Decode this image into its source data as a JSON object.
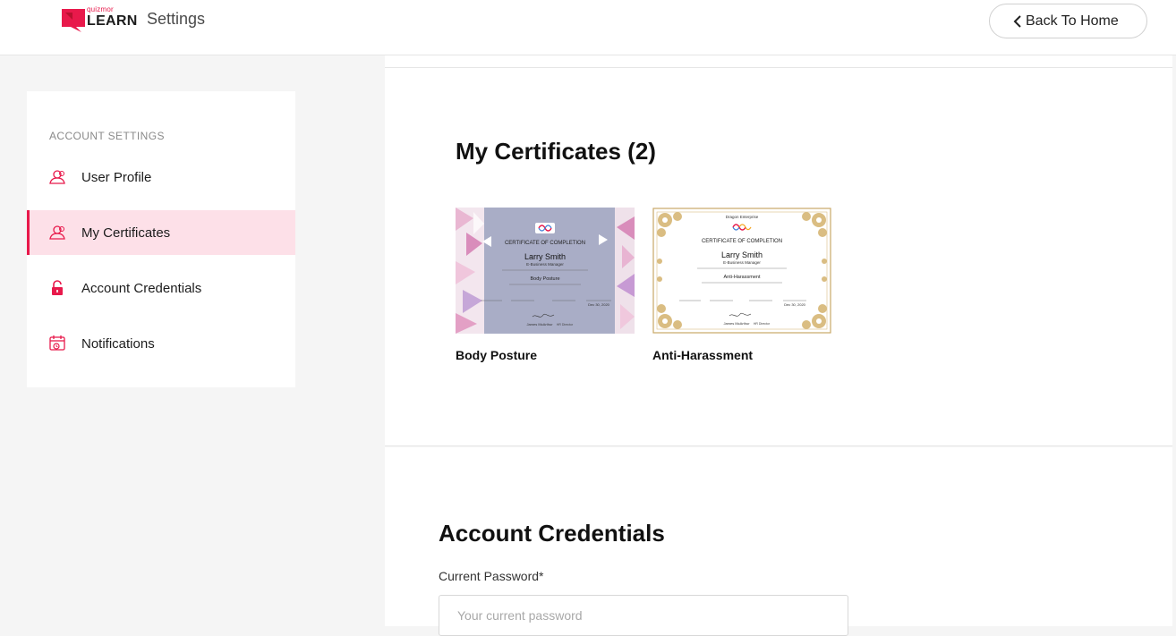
{
  "header": {
    "logo_small": "quizmor",
    "logo_word": "LEARN",
    "title": "Settings",
    "back_button": "Back To Home"
  },
  "sidebar": {
    "heading": "ACCOUNT SETTINGS",
    "items": [
      {
        "label": "User Profile",
        "icon": "user-profile-icon",
        "active": false
      },
      {
        "label": "My Certificates",
        "icon": "certificate-icon",
        "active": true
      },
      {
        "label": "Account Credentials",
        "icon": "lock-icon",
        "active": false
      },
      {
        "label": "Notifications",
        "icon": "notification-icon",
        "active": false
      }
    ]
  },
  "certificates": {
    "title": "My Certificates (2)",
    "items": [
      {
        "name": "Body Posture",
        "thumb": {
          "heading": "CERTIFICATE OF COMPLETION",
          "recipient": "Larry Smith",
          "role": "E-Business Manager",
          "course": "Body Posture",
          "signer": "James McArthur",
          "signer_role": "HR Director",
          "date": "Dec 30, 2020"
        }
      },
      {
        "name": "Anti-Harassment",
        "thumb": {
          "org": "Dragon Enterprise",
          "heading": "CERTIFICATE OF COMPLETION",
          "recipient": "Larry Smith",
          "role": "E-Business Manager",
          "course": "Anti-Harassment",
          "signer": "James McArthur",
          "signer_role": "HR Director",
          "date": "Dec 30, 2020"
        }
      }
    ]
  },
  "credentials": {
    "title": "Account Credentials",
    "current_password_label": "Current Password*",
    "current_password_placeholder": "Your current password",
    "current_password_value": ""
  },
  "colors": {
    "accent": "#e8194b",
    "active_bg": "#fde0e8",
    "page_bg": "#f5f5f5"
  }
}
